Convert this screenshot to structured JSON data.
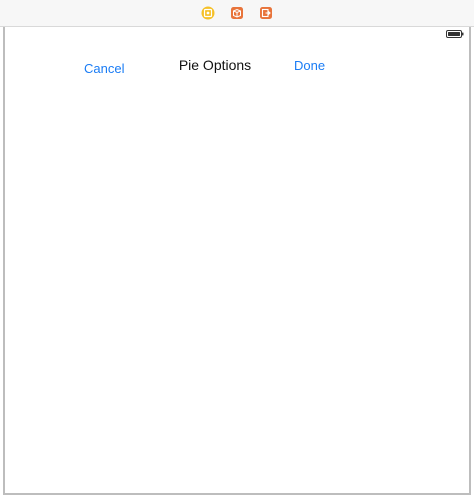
{
  "scene_dock": {
    "icons": [
      {
        "name": "view-controller-icon",
        "color": "#f5c026"
      },
      {
        "name": "first-responder-icon",
        "color": "#e8743b"
      },
      {
        "name": "exit-icon",
        "color": "#e8743b"
      }
    ]
  },
  "status_bar": {
    "icon": "battery-icon"
  },
  "nav_bar": {
    "cancel_label": "Cancel",
    "title": "Pie Options",
    "done_label": "Done",
    "tint_color": "#1a7cf5"
  }
}
